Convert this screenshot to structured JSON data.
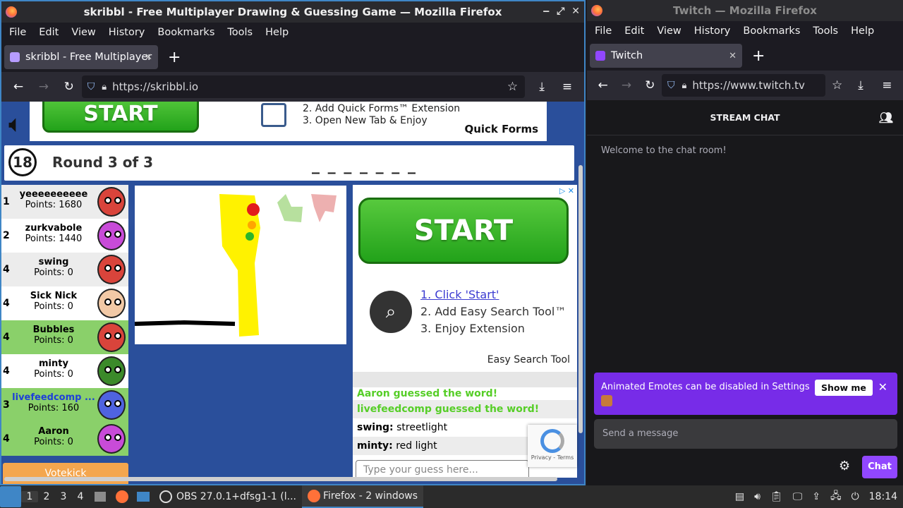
{
  "left_window": {
    "title": "skribbl - Free Multiplayer Drawing & Guessing Game — Mozilla Firefox",
    "menu": [
      "File",
      "Edit",
      "View",
      "History",
      "Bookmarks",
      "Tools",
      "Help"
    ],
    "tab_title": "skribbl - Free Multiplayer",
    "url": "https://skribbl.io"
  },
  "skribbl": {
    "ad_top": {
      "start": "START",
      "line2": "2. Add Quick Forms™ Extension",
      "line3": "3. Open New Tab & Enjoy",
      "brand": "Quick Forms"
    },
    "timer": "18",
    "round": "Round 3 of 3",
    "hint": "_ _ _ _ _ _ _",
    "players": [
      {
        "rank": "1",
        "name": "yeeeeeeeeee",
        "points": "Points: 1680",
        "bg": "#ececec",
        "avatar": "#d9443b"
      },
      {
        "rank": "2",
        "name": "zurkvabole",
        "points": "Points: 1440",
        "bg": "#ffffff",
        "avatar": "#c84bd8"
      },
      {
        "rank": "4",
        "name": "swing",
        "points": "Points: 0",
        "bg": "#ececec",
        "avatar": "#d9443b"
      },
      {
        "rank": "4",
        "name": "Sick Nick",
        "points": "Points: 0",
        "bg": "#ffffff",
        "avatar": "#f2c9a6"
      },
      {
        "rank": "4",
        "name": "Bubbles",
        "points": "Points: 0",
        "bg": "#8ad06a",
        "avatar": "#d9443b"
      },
      {
        "rank": "4",
        "name": "minty",
        "points": "Points: 0",
        "bg": "#ffffff",
        "avatar": "#3b8a2a"
      },
      {
        "rank": "3",
        "name": "livefeedcomp ...",
        "points": "Points: 160",
        "bg": "#8ad06a",
        "avatar": "#4f63e0"
      },
      {
        "rank": "4",
        "name": "Aaron",
        "points": "Points: 0",
        "bg": "#8ad06a",
        "avatar": "#c84bd8"
      }
    ],
    "ad_right": {
      "start": "START",
      "step1": "1. Click 'Start'",
      "step2": "2. Add Easy Search Tool™",
      "step3": "3. Enjoy Extension",
      "brand": "Easy Search Tool"
    },
    "chat": [
      {
        "type": "guess",
        "text": "Aaron guessed the word!"
      },
      {
        "type": "guess",
        "text": "livefeedcomp guessed the word!"
      },
      {
        "type": "msg",
        "user": "swing:",
        "text": " streetlight"
      },
      {
        "type": "msg",
        "user": "minty:",
        "text": " red light"
      }
    ],
    "guess_placeholder": "Type your guess here...",
    "votekick": "Votekick",
    "recaptcha": "Privacy - Terms"
  },
  "right_window": {
    "title": "Twitch — Mozilla Firefox",
    "menu": [
      "File",
      "Edit",
      "View",
      "History",
      "Bookmarks",
      "Tools",
      "Help"
    ],
    "tab_title": "Twitch",
    "url": "https://www.twitch.tv"
  },
  "twitch": {
    "header": "STREAM CHAT",
    "welcome": "Welcome to the chat room!",
    "notice": "Animated Emotes can be disabled in Settings",
    "show_me": "Show me",
    "placeholder": "Send a message",
    "chat_button": "Chat"
  },
  "taskbar": {
    "workspaces": [
      "1",
      "2",
      "3",
      "4"
    ],
    "obs": "OBS 27.0.1+dfsg1-1 (l...",
    "firefox": "Firefox - 2 windows",
    "clock": "18:14"
  }
}
